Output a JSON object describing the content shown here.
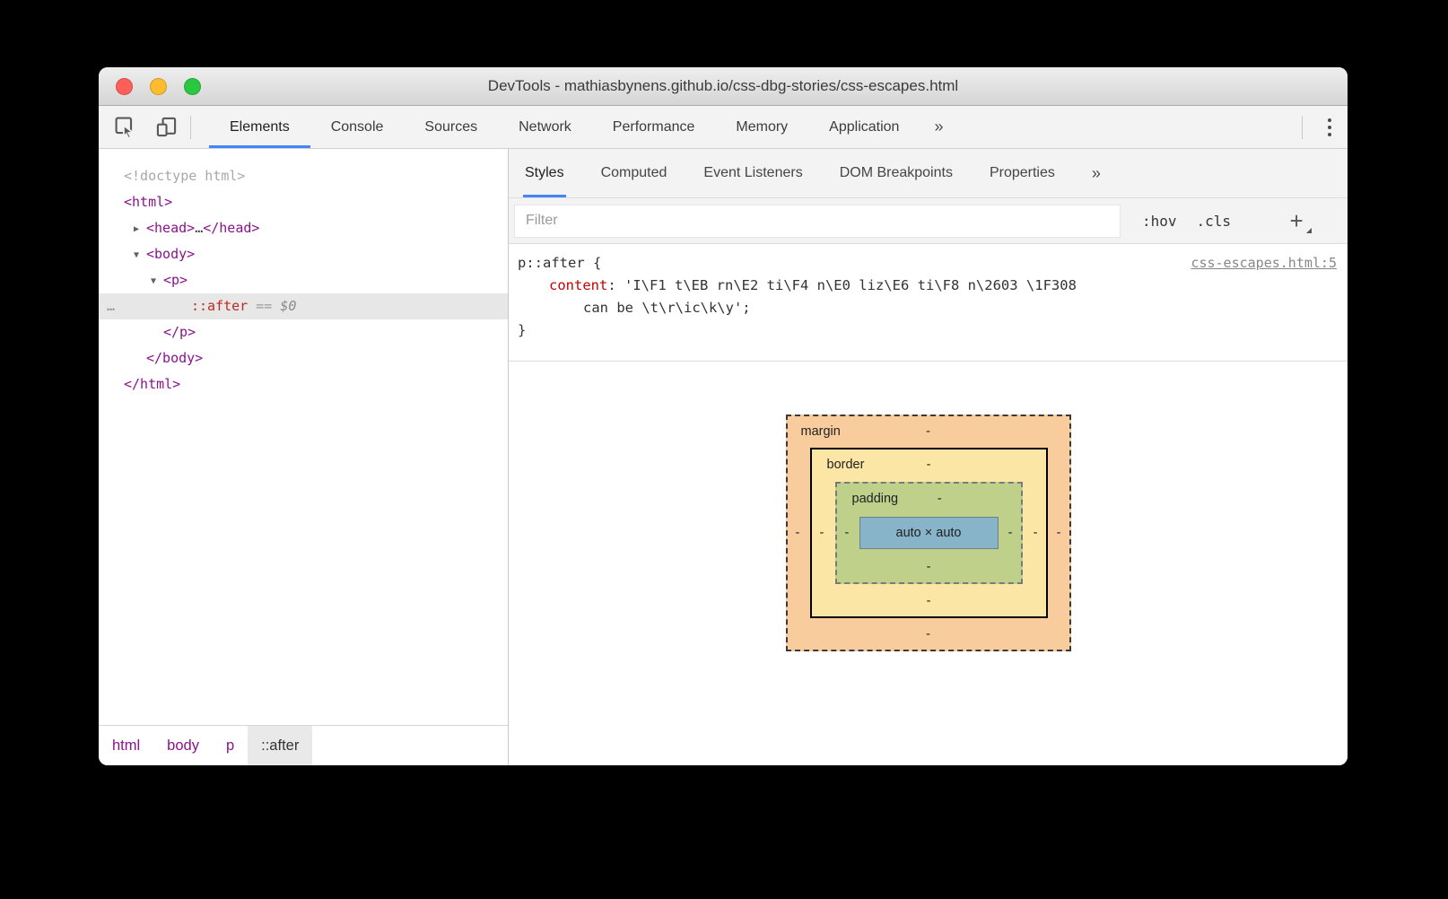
{
  "window": {
    "title": "DevTools - mathiasbynens.github.io/css-dbg-stories/css-escapes.html"
  },
  "toolbar": {
    "tabs": [
      "Elements",
      "Console",
      "Sources",
      "Network",
      "Performance",
      "Memory",
      "Application"
    ],
    "more_label": "»"
  },
  "dom_tree": {
    "doctype": "<!doctype html>",
    "html_open": "<html>",
    "head_open": "<head>",
    "head_ellipsis": "…",
    "head_close": "</head>",
    "body_open": "<body>",
    "p_open": "<p>",
    "after_dots": "…",
    "after_name": "::after",
    "after_eq": "==",
    "after_dollar": "$0",
    "p_close": "</p>",
    "body_close": "</body>",
    "html_close": "</html>"
  },
  "breadcrumbs": {
    "items": [
      "html",
      "body",
      "p",
      "::after"
    ]
  },
  "styles_panel": {
    "tabs": [
      "Styles",
      "Computed",
      "Event Listeners",
      "DOM Breakpoints",
      "Properties"
    ],
    "more_label": "»",
    "filter_placeholder": "Filter",
    "hov_label": ":hov",
    "cls_label": ".cls",
    "add_label": "+",
    "rule": {
      "selector": "p::after {",
      "source_link": "css-escapes.html:5",
      "property": "content",
      "separator": ": ",
      "value_line1": "'I\\F1 t\\EB rn\\E2 ti\\F4 n\\E0 liz\\E6 ti\\F8 n\\2603 \\1F308",
      "value_line2": "can be \\t\\r\\ic\\k\\y';",
      "close_brace": "}"
    }
  },
  "box_model": {
    "margin_label": "margin",
    "border_label": "border",
    "padding_label": "padding",
    "content_label": "auto × auto",
    "dash": "-"
  },
  "colors": {
    "accent-blue": "#4285f4",
    "tag-purple": "#8b128b",
    "pseudo-red": "#bc2a20",
    "property-red": "#c80000",
    "traffic-red": "#ff5f57",
    "traffic-yellow": "#febc2e",
    "traffic-green": "#2ac840",
    "bm-margin": "#f9cc9d",
    "bm-border": "#fce6a6",
    "bm-padding": "#bfd08a",
    "bm-content": "#88b4c9"
  }
}
